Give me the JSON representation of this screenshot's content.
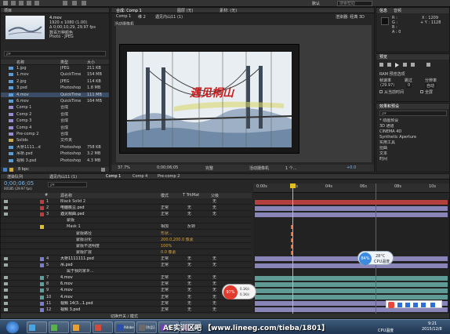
{
  "app": {
    "top_right": "默认",
    "search_placeholder": "搜索帮助"
  },
  "project": {
    "tab": "项目",
    "preview": {
      "name": "4.mov",
      "size": "1920 x 1080 (1.00)",
      "duration": "Δ 0;00;10;29, 29.97 fps",
      "note": "数百万种颜色",
      "codec": "Photo - JPEG"
    },
    "search_placeholder": "ρ▾",
    "headers": [
      "名称",
      "类型",
      "大小"
    ],
    "items": [
      {
        "name": "1.jpg",
        "type": "JPEG",
        "size": "211 KB"
      },
      {
        "name": "1.mov",
        "type": "QuickTime",
        "size": "154 MB"
      },
      {
        "name": "2.jpg",
        "type": "JPEG",
        "size": "114 KB"
      },
      {
        "name": "3.psd",
        "type": "Photoshop",
        "size": "1.8 MB"
      },
      {
        "name": "4.mov",
        "type": "QuickTime",
        "size": "111 MB"
      },
      {
        "name": "6.mov",
        "type": "QuickTime",
        "size": "164 MB"
      },
      {
        "name": "Comp 1",
        "type": "合成",
        "size": ""
      },
      {
        "name": "Comp 2",
        "type": "合成",
        "size": ""
      },
      {
        "name": "Comp 3",
        "type": "合成",
        "size": ""
      },
      {
        "name": "Comp 4",
        "type": "合成",
        "size": ""
      },
      {
        "name": "Pre-comp 2",
        "type": "合成",
        "size": ""
      },
      {
        "name": "Solids",
        "type": "文件夹",
        "size": ""
      },
      {
        "name": "大桥1111...d",
        "type": "Photoshop",
        "size": "758 KB"
      },
      {
        "name": "吊桥.psd",
        "type": "Photoshop",
        "size": "3.2 MB"
      },
      {
        "name": "视频 3.psd",
        "type": "Photoshop",
        "size": "4.3 MB"
      }
    ],
    "footer": "8 bpc"
  },
  "comp": {
    "tabs": [
      "合成: Comp 1",
      "图层 (无)",
      "素材: (无)"
    ],
    "breadcrumb": [
      "Comp 1",
      "维 2",
      "遇见内山11 (1)"
    ],
    "renderer": "渲染器: 经典 3D",
    "view_label": "活动摄像机",
    "canvas_text": "遇见桐山",
    "zoom": "37.7%",
    "timecode": "0;00;06;05",
    "quality": "完整",
    "camera": "活动摄像机",
    "views": "1 个...",
    "exposure": "+0.0"
  },
  "info": {
    "tabs": [
      "信息",
      "音频"
    ],
    "r": "R :",
    "g": "G :",
    "b": "B :",
    "a": "A : 0",
    "x": "X : 1209",
    "y": "+ Y : 1128"
  },
  "preview_panel": {
    "tab": "预览",
    "ram": "RAM 预览选项",
    "fps_label": "帧速率",
    "skip_label": "跳过",
    "res_label": "分辨率",
    "fps": "(29.97)",
    "skip": "0",
    "res": "自动",
    "from_current": "从当前时间",
    "fullscreen": "全屏"
  },
  "effects": {
    "tab": "效果和预设",
    "search_placeholder": "ρ▾",
    "items": [
      "* 动画预设",
      "3D 通道",
      "CINEMA 4D",
      "Synthetic Aperture",
      "实用工具",
      "扭曲",
      "文本",
      "时间"
    ]
  },
  "timeline": {
    "tabs": [
      "渲染队列",
      "遇见内山11 (1)",
      "Comp 1",
      "Comp 4",
      "Pre-comp 2"
    ],
    "timecode": "0;00;06;05",
    "timecode_sub": "00185 (29.97 fps)",
    "search_placeholder": "ρ▾",
    "headers": [
      "#",
      "源名称",
      "模式",
      "T TrkMat",
      "父级"
    ],
    "ruler": [
      "0:00s",
      "02s",
      "04s",
      "06s",
      "08s",
      "10s"
    ],
    "layers": [
      {
        "num": "1",
        "name": "Black Solid 2",
        "color": "#c23b3b",
        "mode": "",
        "trk": "",
        "parent": "无",
        "kind": "solid"
      },
      {
        "num": "2",
        "name": "电脑桃豆.psd",
        "color": "#c23b3b",
        "mode": "正常",
        "trk": "无",
        "parent": "无",
        "kind": "layer"
      },
      {
        "num": "3",
        "name": "遇见桐曲.psd",
        "color": "#c23b3b",
        "mode": "正常",
        "trk": "无",
        "parent": "无",
        "kind": "layer"
      },
      {
        "num": "",
        "name": "蒙版",
        "color": "",
        "mode": "",
        "trk": "",
        "parent": "",
        "kind": "group"
      },
      {
        "num": "",
        "name": "Mask 1",
        "color": "#e0c020",
        "mode": "相加",
        "trk": "反转",
        "parent": "",
        "kind": "mask"
      },
      {
        "num": "",
        "name": "蒙版路径",
        "color": "",
        "mode": "形状...",
        "trk": "",
        "parent": "",
        "kind": "prop"
      },
      {
        "num": "",
        "name": "蒙版羽化",
        "color": "",
        "mode": "200.0,200.0 像素",
        "trk": "",
        "parent": "",
        "kind": "prop"
      },
      {
        "num": "",
        "name": "蒙版不透明度",
        "color": "",
        "mode": "100%",
        "trk": "",
        "parent": "",
        "kind": "prop"
      },
      {
        "num": "",
        "name": "蒙版扩展",
        "color": "",
        "mode": "0.0 像素",
        "trk": "",
        "parent": "",
        "kind": "prop"
      },
      {
        "num": "4",
        "name": "大桥1111111.psd",
        "color": "#7b7bd0",
        "mode": "正常",
        "trk": "无",
        "parent": "无",
        "kind": "layer"
      },
      {
        "num": "5",
        "name": "吊.psd",
        "color": "#7b7bd0",
        "mode": "正常",
        "trk": "无",
        "parent": "无",
        "kind": "layer"
      },
      {
        "num": "",
        "name": "属于我的家乡...",
        "color": "",
        "mode": "",
        "trk": "",
        "parent": "",
        "kind": "sub"
      },
      {
        "num": "7",
        "name": "4.mov",
        "color": "#5aa0a0",
        "mode": "正常",
        "trk": "无",
        "parent": "无",
        "kind": "layer"
      },
      {
        "num": "8",
        "name": "6.mov",
        "color": "#5aa0a0",
        "mode": "正常",
        "trk": "无",
        "parent": "无",
        "kind": "layer"
      },
      {
        "num": "9",
        "name": "4.mov",
        "color": "#5aa0a0",
        "mode": "正常",
        "trk": "无",
        "parent": "无",
        "kind": "layer"
      },
      {
        "num": "10",
        "name": "4.mov",
        "color": "#5aa0a0",
        "mode": "正常",
        "trk": "无",
        "parent": "无",
        "kind": "layer"
      },
      {
        "num": "11",
        "name": "视频 14(3...1.psd",
        "color": "#7b7bd0",
        "mode": "正常",
        "trk": "无",
        "parent": "无",
        "kind": "layer"
      },
      {
        "num": "12",
        "name": "视频 3.psd",
        "color": "#7b7bd0",
        "mode": "正常",
        "trk": "无",
        "parent": "无",
        "kind": "layer"
      }
    ],
    "footer": "切换开关 / 模式"
  },
  "overlays": {
    "cpu_badge": "84%",
    "cpu_temp": "28°C",
    "cpu_label": "CPU温度",
    "net_badge": "97%",
    "net_up": "0.1K/s",
    "net_down": "0.1K/s"
  },
  "watermark": "AE实训区吧 【www.lineeg.com/tieba/1801】",
  "taskbar": {
    "items": [
      "",
      "",
      "",
      "",
      "Adobe Ph...",
      "[作品]...",
      "AE...",
      "Adobe Af..."
    ],
    "tray_label": "CPU温度",
    "time": "9:21",
    "date": "2015/12/8"
  },
  "colors": {
    "panel": "#262626",
    "accent": "#2d8cf0",
    "playhead": "#e0c020",
    "solid_bar": "#b3403d",
    "layer_bar": "#8a85b8",
    "mov_bar": "#5f9a94"
  }
}
